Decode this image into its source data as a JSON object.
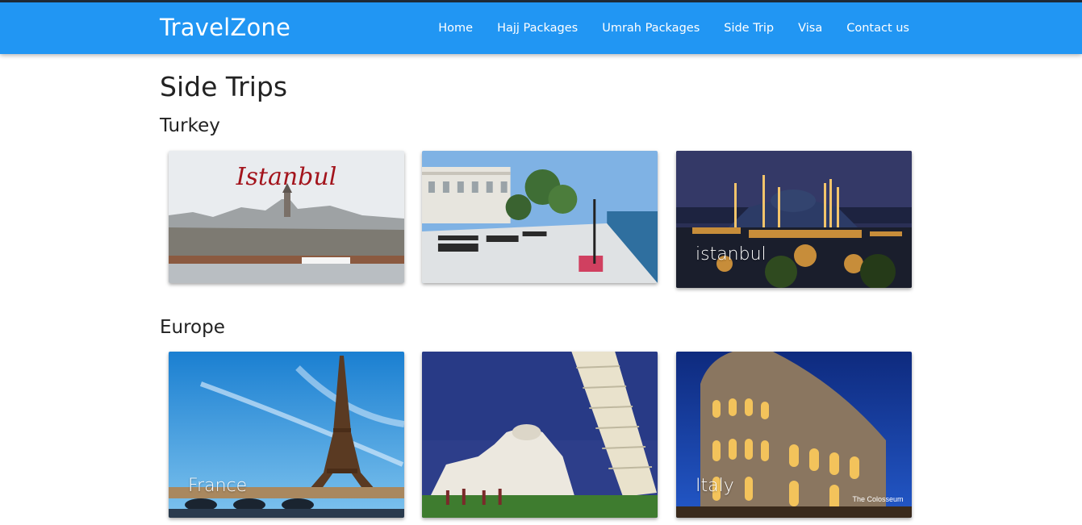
{
  "brand": "TravelZone",
  "nav": {
    "items": [
      {
        "label": "Home"
      },
      {
        "label": "Hajj Packages"
      },
      {
        "label": "Umrah Packages"
      },
      {
        "label": "Side Trip"
      },
      {
        "label": "Visa"
      },
      {
        "label": "Contact us"
      }
    ]
  },
  "page": {
    "title": "Side Trips"
  },
  "sections": [
    {
      "title": "Turkey",
      "cards": [
        {
          "image_text": "Istanbul",
          "caption": ""
        },
        {
          "caption": ""
        },
        {
          "caption": "istanbul"
        }
      ]
    },
    {
      "title": "Europe",
      "cards": [
        {
          "caption": "France"
        },
        {
          "caption": ""
        },
        {
          "caption": "Italy",
          "image_text": "The Colosseum"
        }
      ]
    }
  ]
}
